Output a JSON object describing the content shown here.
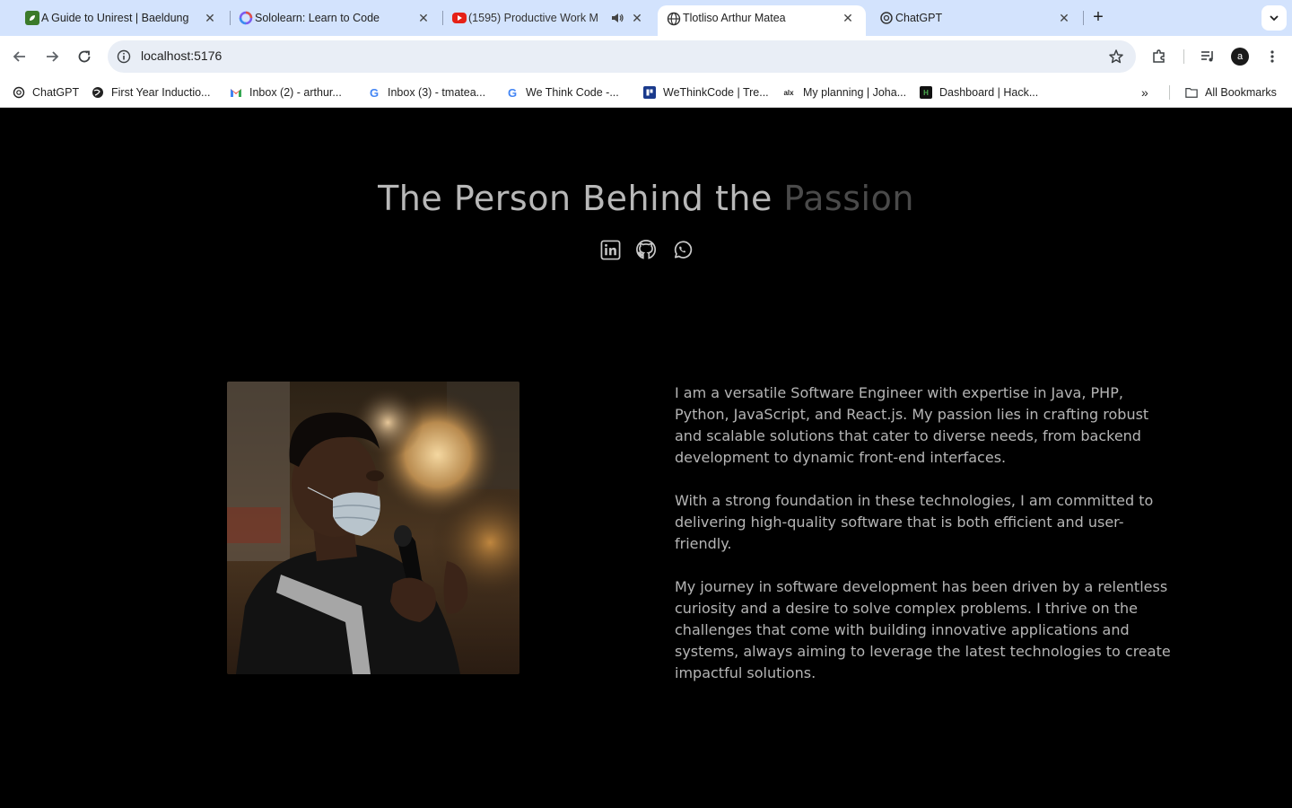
{
  "browser": {
    "tabs": [
      {
        "title": "A Guide to Unirest | Baeldung",
        "active": false
      },
      {
        "title": "Sololearn: Learn to Code",
        "active": false
      },
      {
        "title": "(1595) Productive Work M",
        "active": false,
        "audio": true
      },
      {
        "title": "Tlotliso Arthur Matea",
        "active": true
      },
      {
        "title": "ChatGPT",
        "active": false
      }
    ],
    "new_tab": "+",
    "url": "localhost:5176",
    "profile_initial": "a",
    "bookmarks": [
      {
        "label": "ChatGPT"
      },
      {
        "label": "First Year Inductio..."
      },
      {
        "label": "Inbox (2) - arthur..."
      },
      {
        "label": "Inbox (3) - tmatea..."
      },
      {
        "label": "We Think Code -..."
      },
      {
        "label": "WeThinkCode | Tre..."
      },
      {
        "label": "My planning | Joha..."
      },
      {
        "label": "Dashboard | Hack..."
      }
    ],
    "more_bookmarks": "»",
    "all_bookmarks": "All Bookmarks"
  },
  "hero": {
    "title_main": "The Person Behind the ",
    "title_fade": "Passion"
  },
  "social_links": [
    "linkedin-icon",
    "github-icon",
    "whatsapp-icon"
  ],
  "about": {
    "paragraphs": [
      "I am a versatile Software Engineer with expertise in Java, PHP, Python, JavaScript, and React.js. My passion lies in crafting robust and scalable solutions that cater to diverse needs, from backend development to dynamic front-end interfaces.",
      "With a strong foundation in these technologies, I am committed to delivering high-quality software that is both efficient and user-friendly.",
      "My journey in software development has been driven by a relentless curiosity and a desire to solve complex problems. I thrive on the challenges that come with building innovative applications and systems, always aiming to leverage the latest technologies to create impactful solutions."
    ]
  },
  "colors": {
    "page_bg": "#000000",
    "text": "#b5b5b5",
    "tabstrip": "#d3e3fd"
  }
}
